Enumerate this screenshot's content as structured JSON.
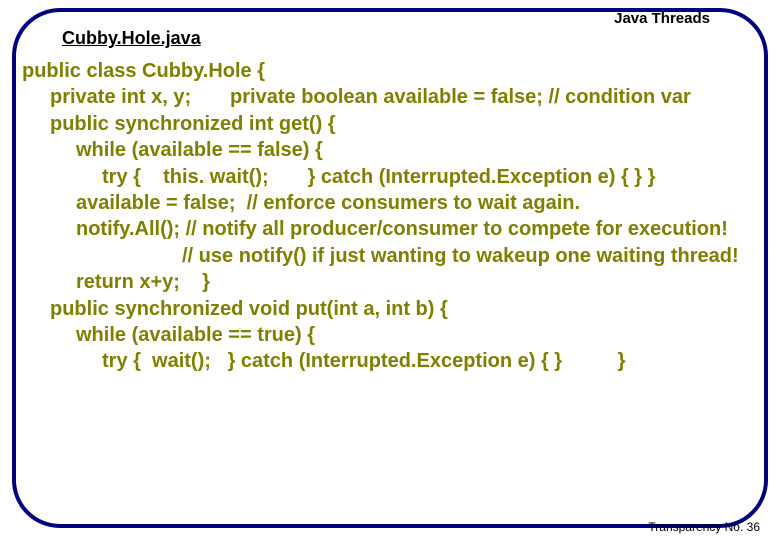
{
  "header": {
    "topic": "Java Threads",
    "filename": "Cubby.Hole.java"
  },
  "code": {
    "l01": "public class Cubby.Hole {",
    "l02": "private int x, y;       private boolean available = false; // condition var",
    "l03": "public synchronized int get() {",
    "l04": "while (available == false) {",
    "l05": "try {    this. wait();       } catch (Interrupted.Exception e) { } }",
    "l06": "available = false;  // enforce consumers to wait again.",
    "l07": "notify.All(); // notify all producer/consumer to compete for execution!",
    "l08": "// use notify() if just wanting to wakeup one waiting thread!",
    "l09": "return x+y;    }",
    "l10": "public synchronized void put(int a, int b) {",
    "l11": "while (available == true) {",
    "l12": "try {  wait();   } catch (Interrupted.Exception e) { }          }"
  },
  "footer": {
    "transparency": "Transparency No. 36"
  }
}
